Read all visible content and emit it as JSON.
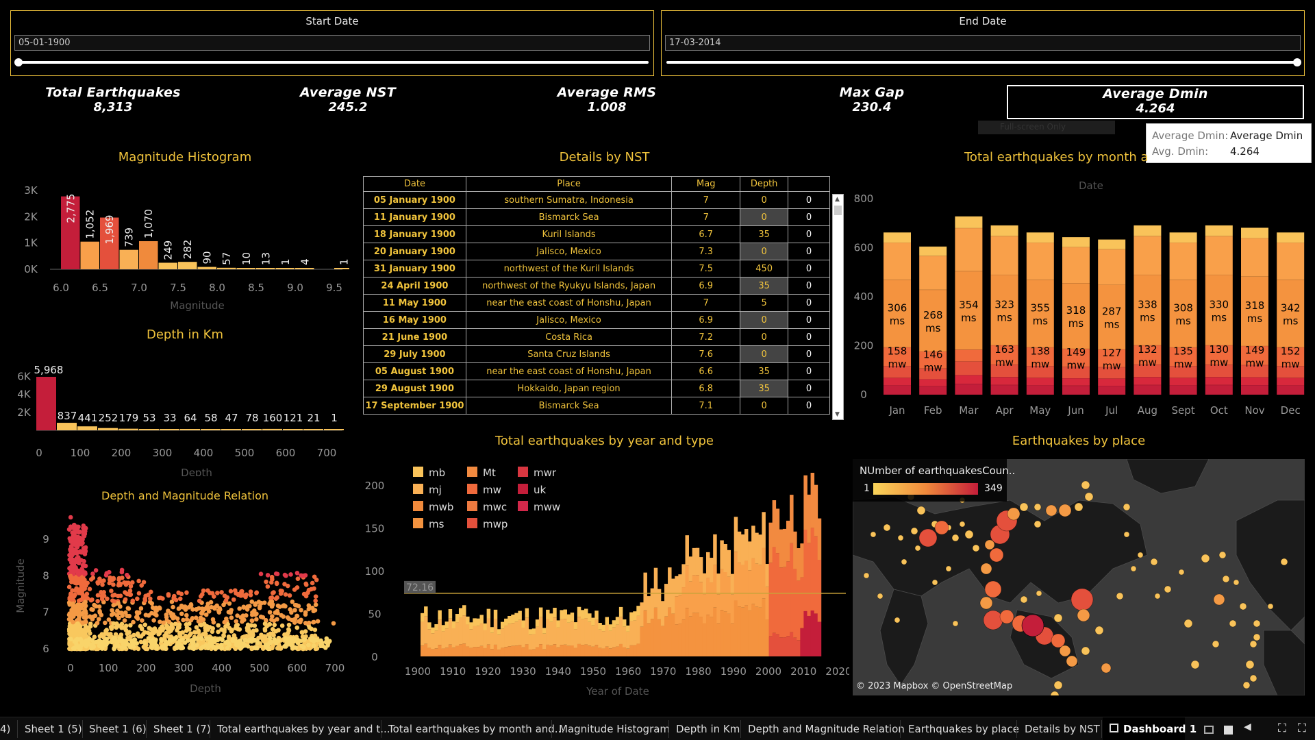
{
  "filters": {
    "start": {
      "title": "Start Date",
      "value": "05-01-1900"
    },
    "end": {
      "title": "End Date",
      "value": "17-03-2014"
    }
  },
  "kpis": [
    {
      "label": "Total Earthquakes",
      "value": "8,313"
    },
    {
      "label": "Average NST",
      "value": "245.2"
    },
    {
      "label": "Average RMS",
      "value": "1.008"
    },
    {
      "label": "Max Gap",
      "value": "230.4"
    },
    {
      "label": "Average Dmin",
      "value": "4.264"
    }
  ],
  "fullscreen_hint": "Full-screen Only",
  "tooltip": {
    "row1_key": "Average Dmin:",
    "row1_val": "Average Dmin",
    "row2_key": "Avg. Dmin:",
    "row2_val": "4.264"
  },
  "titles": {
    "histogram": "Magnitude Histogram",
    "details": "Details by NST",
    "monthly": "Total earthquakes by month a",
    "depth": "Depth in Km",
    "relation": "Depth and Magnitude Relation",
    "yearly": "Total earthquakes by year and type",
    "map": "Earthquakes by place"
  },
  "colors": {
    "accent": "#f0c33c",
    "dark_red": "#c41e3a",
    "orange": "#f08a3c",
    "light": "#f9c35a"
  },
  "chart_data": [
    {
      "id": "magnitude_histogram",
      "type": "bar",
      "xlabel": "Magnitude",
      "x_ticks": [
        "6.0",
        "6.5",
        "7.0",
        "7.5",
        "8.0",
        "8.5",
        "9.0",
        "9.5"
      ],
      "y_ticks": [
        "0K",
        "1K",
        "2K",
        "3K"
      ],
      "bins": [
        6.0,
        6.25,
        6.5,
        6.75,
        7.0,
        7.25,
        7.5,
        7.75,
        8.0,
        8.25,
        8.5,
        8.75,
        9.0,
        9.25,
        9.5
      ],
      "values": [
        2775,
        1052,
        1969,
        739,
        1070,
        249,
        282,
        90,
        57,
        10,
        13,
        1,
        4,
        0,
        1
      ],
      "labels": [
        "2,775",
        "1,052",
        "1,969",
        "739",
        "1,070",
        "249",
        "282",
        "90",
        "57",
        "10",
        "13",
        "1",
        "4",
        "",
        "1"
      ],
      "ylim": [
        0,
        3000
      ]
    },
    {
      "id": "depth_histogram",
      "type": "bar",
      "xlabel": "Depth",
      "x_ticks": [
        "0",
        "100",
        "200",
        "300",
        "400",
        "500",
        "600",
        "700"
      ],
      "y_ticks": [
        "2K",
        "4K",
        "6K"
      ],
      "values": [
        5968,
        837,
        441,
        252,
        179,
        53,
        33,
        64,
        58,
        47,
        78,
        160,
        121,
        21,
        1
      ],
      "labels": [
        "5,968",
        "837",
        "441",
        "252",
        "179",
        "53",
        "33",
        "64",
        "58",
        "47",
        "78",
        "160",
        "121",
        "21",
        "1"
      ],
      "ylim": [
        0,
        6500
      ]
    },
    {
      "id": "monthly",
      "type": "bar",
      "xlabel": "Date",
      "categories": [
        "Jan",
        "Feb",
        "Mar",
        "Apr",
        "May",
        "Jun",
        "Jul",
        "Aug",
        "Sept",
        "Oct",
        "Nov",
        "Dec"
      ],
      "y_ticks": [
        "0",
        "200",
        "400",
        "600",
        "800"
      ],
      "totals": [
        690,
        630,
        800,
        720,
        690,
        670,
        660,
        720,
        690,
        720,
        710,
        690
      ],
      "ms": [
        306,
        268,
        354,
        323,
        355,
        318,
        287,
        338,
        308,
        330,
        318,
        342
      ],
      "mw": [
        158,
        146,
        0,
        163,
        138,
        149,
        127,
        132,
        135,
        130,
        149,
        152
      ],
      "ms_labels": [
        "306 ms",
        "268 ms",
        "354 ms",
        "323 ms",
        "355 ms",
        "318 ms",
        "287 ms",
        "338 ms",
        "308 ms",
        "330 ms",
        "318 ms",
        "342 ms"
      ],
      "mw_labels": [
        "158 mw",
        "146 mw",
        "",
        "163 mw",
        "138 mw",
        "149 mw",
        "127 mw",
        "132 mw",
        "135 mw",
        "130 mw",
        "149 mw",
        "152 mw"
      ],
      "ylim": [
        0,
        800
      ]
    },
    {
      "id": "relation",
      "type": "scatter",
      "xlabel": "Depth",
      "ylabel": "Magnitude",
      "x_ticks": [
        "0",
        "100",
        "200",
        "300",
        "400",
        "500",
        "600",
        "700"
      ],
      "y_ticks": [
        "6",
        "7",
        "8",
        "9"
      ],
      "xlim": [
        -5,
        710
      ],
      "ylim": [
        5.8,
        9.8
      ]
    },
    {
      "id": "yearly",
      "type": "area",
      "xlabel": "Year of Date",
      "x_ticks": [
        "1900",
        "1910",
        "1920",
        "1930",
        "1940",
        "1950",
        "1960",
        "1970",
        "1980",
        "1990",
        "2000",
        "2010",
        "2020"
      ],
      "y_ticks": [
        "0",
        "50",
        "100",
        "150",
        "200"
      ],
      "reference_line": {
        "value": 72.16,
        "label": "72.16"
      },
      "legend": [
        "mb",
        "mj",
        "mwb",
        "ms",
        "Mt",
        "mw",
        "mwc",
        "mwp",
        "mwr",
        "uk",
        "mww"
      ],
      "ylim": [
        0,
        210
      ]
    },
    {
      "id": "map",
      "type": "map",
      "legend_title": "NUmber of earthquakesCoun..",
      "legend_min": "1",
      "legend_max": "349",
      "attribution": "© 2023 Mapbox © OpenStreetMap"
    }
  ],
  "table": {
    "headers": [
      "Date",
      "Place",
      "Mag",
      "Depth",
      ""
    ],
    "rows": [
      [
        "05 January 1900",
        "southern Sumatra, Indonesia",
        "7",
        "0",
        "0"
      ],
      [
        "11 January 1900",
        "Bismarck Sea",
        "7",
        "0",
        "0"
      ],
      [
        "18 January 1900",
        "Kuril Islands",
        "6.7",
        "35",
        "0"
      ],
      [
        "20 January 1900",
        "Jalisco, Mexico",
        "7.3",
        "0",
        "0"
      ],
      [
        "31 January 1900",
        "northwest of the Kuril Islands",
        "7.5",
        "450",
        "0"
      ],
      [
        "24 April 1900",
        "northwest of the Ryukyu Islands, Japan",
        "6.9",
        "35",
        "0"
      ],
      [
        "11 May 1900",
        "near the east coast of Honshu, Japan",
        "7",
        "5",
        "0"
      ],
      [
        "16 May 1900",
        "Jalisco, Mexico",
        "6.9",
        "0",
        "0"
      ],
      [
        "21 June 1900",
        "Costa Rica",
        "7.2",
        "0",
        "0"
      ],
      [
        "29 July 1900",
        "Santa Cruz Islands",
        "7.6",
        "0",
        "0"
      ],
      [
        "05 August 1900",
        "near the east coast of Honshu, Japan",
        "6.6",
        "35",
        "0"
      ],
      [
        "29 August 1900",
        "Hokkaido, Japan region",
        "6.8",
        "35",
        "0"
      ],
      [
        "17 September 1900",
        "Bismarck Sea",
        "7.1",
        "0",
        "0"
      ]
    ]
  },
  "tabs": [
    "4)",
    "Sheet 1 (5)",
    "Sheet 1 (6)",
    "Sheet 1 (7)",
    "Total earthquakes by year and t...",
    "Total earthquakes by month and...",
    "Magnitude Histogram",
    "Depth in Km",
    "Depth and Magnitude Relation",
    "Earthquakes by place",
    "Details by NST",
    "Dashboard 1"
  ]
}
